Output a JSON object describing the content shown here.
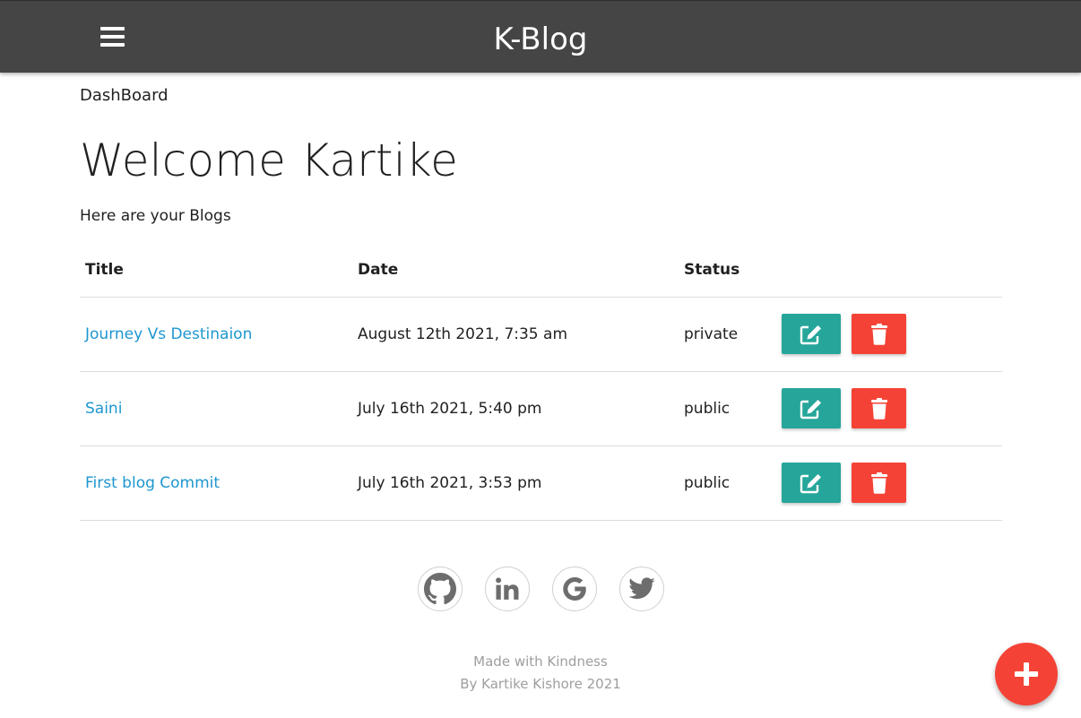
{
  "navbar": {
    "brand": "K-Blog",
    "menu_icon": "hamburger-menu-icon",
    "bg_color": "#454545"
  },
  "breadcrumb": "DashBoard",
  "welcome": "Welcome Kartike",
  "subtitle": "Here are your Blogs",
  "table": {
    "headers": [
      "Title",
      "Date",
      "Status"
    ],
    "rows": [
      {
        "title": "Journey Vs Destinaion",
        "date": "August 12th 2021, 7:35 am",
        "status": "private"
      },
      {
        "title": "Saini",
        "date": "July 16th 2021, 5:40 pm",
        "status": "public"
      },
      {
        "title": "First blog Commit",
        "date": "July 16th 2021, 3:53 pm",
        "status": "public"
      }
    ],
    "edit_icon": "edit-icon",
    "delete_icon": "trash-icon",
    "edit_color": "#26a69a",
    "delete_color": "#f44336",
    "link_color": "#1e96cf"
  },
  "social": [
    "github-icon",
    "linkedin-icon",
    "google-icon",
    "twitter-icon"
  ],
  "footer": {
    "line1": "Made with Kindness",
    "line2": "By Kartike Kishore 2021"
  },
  "fab_icon": "plus-icon",
  "fab_color": "#f44336"
}
